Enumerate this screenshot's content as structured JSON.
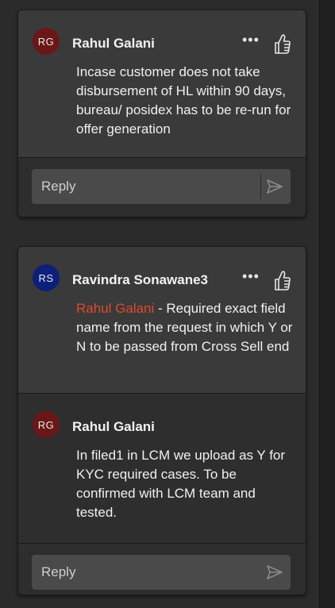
{
  "threads": [
    {
      "comments": [
        {
          "initials": "RG",
          "author": "Rahul Galani",
          "body": "Incase customer does not take disbursement of HL within 90 days, bureau/ posidex has to be re-run for offer generation"
        }
      ],
      "reply_placeholder": "Reply"
    },
    {
      "comments": [
        {
          "initials": "RS",
          "author": "Ravindra Sonawane3",
          "mention": "Rahul Galani",
          "body": " - Required exact field name from the request in which Y or N to be passed from Cross Sell end"
        },
        {
          "initials": "RG",
          "author": "Rahul Galani",
          "body": "In filed1 in LCM we upload as Y for KYC required cases. To be confirmed with LCM team and tested."
        }
      ],
      "reply_placeholder": "Reply"
    }
  ],
  "icons": {
    "more": "more-options-icon",
    "like": "thumbs-up-icon",
    "send": "send-icon"
  },
  "colors": {
    "avatar_rg": "#6a1717",
    "avatar_rs": "#0c1f7a",
    "mention": "#e0482f"
  }
}
